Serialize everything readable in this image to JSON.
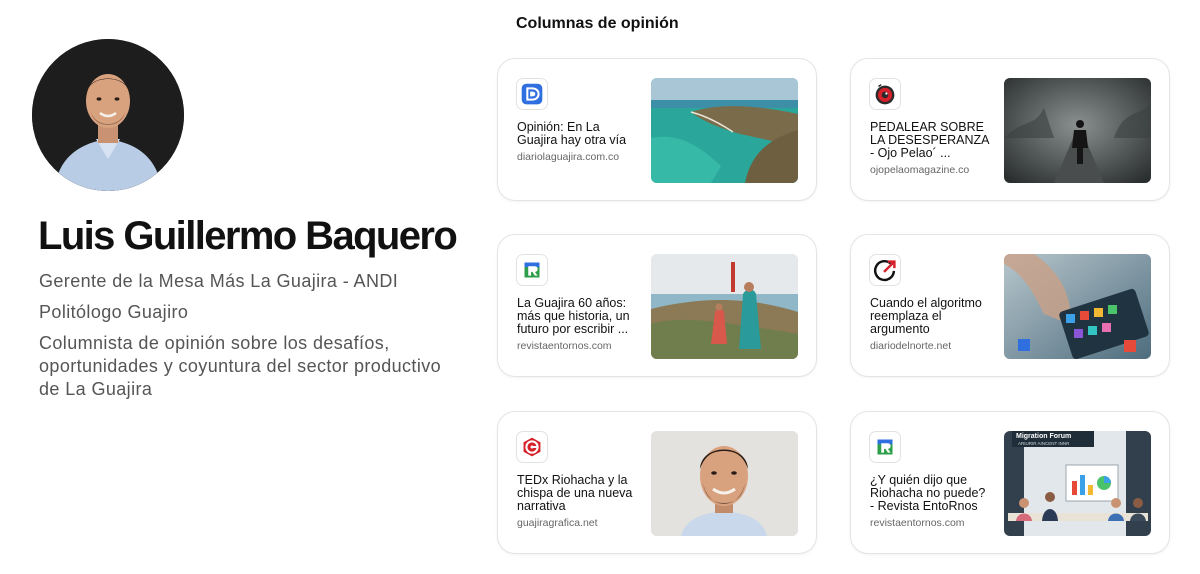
{
  "profile": {
    "name": "Luis Guillermo Baquero",
    "role": "Gerente de la Mesa Más La Guajira - ANDI",
    "profession": "Politólogo Guajiro",
    "bio": "Columnista de opinión sobre los desafíos, oportunidades y coyuntura del sector productivo de La Guajira"
  },
  "section_title": "Columnas de opinión",
  "articles": [
    {
      "title": "Opinión: En La Guajira hay otra vía",
      "source": "diariolaguajira.com.co",
      "favicon": "diariolaguajira-d-icon",
      "image": "coastline-cliffs-image"
    },
    {
      "title": "PEDALEAR SOBRE LA DESESPERANZA - Ojo Pelao´ ...",
      "source": "ojopelaomagazine.co",
      "favicon": "eye-lens-icon",
      "image": "cyclist-in-fog-image"
    },
    {
      "title": "La Guajira 60 años: más que historia, un futuro por escribir ...",
      "source": "revistaentornos.com",
      "favicon": "entornos-r-icon",
      "image": "women-walking-coast-image"
    },
    {
      "title": "Cuando el algoritmo reemplaza el argumento",
      "source": "diariodelnorte.net",
      "favicon": "diariodelnorte-arrow-icon",
      "image": "phone-apps-image"
    },
    {
      "title": "TEDx Riohacha y la chispa de una nueva narrativa",
      "source": "guajiragrafica.net",
      "favicon": "guajiragrafica-g-icon",
      "image": "author-portrait-image"
    },
    {
      "title": "¿Y quién dijo que Riohacha no puede? - Revista EntoRnos",
      "source": "revistaentornos.com",
      "favicon": "entornos-r-icon",
      "image": "meeting-forum-image",
      "image_caption": "Migration Forum",
      "image_subcaption": "ARIURIR AINCENT INNR"
    }
  ],
  "colors": {
    "accent_blue": "#2f6fe0",
    "accent_red": "#d6202a",
    "accent_green": "#2e9e4a",
    "text_primary": "#111111",
    "text_secondary": "#555555"
  }
}
